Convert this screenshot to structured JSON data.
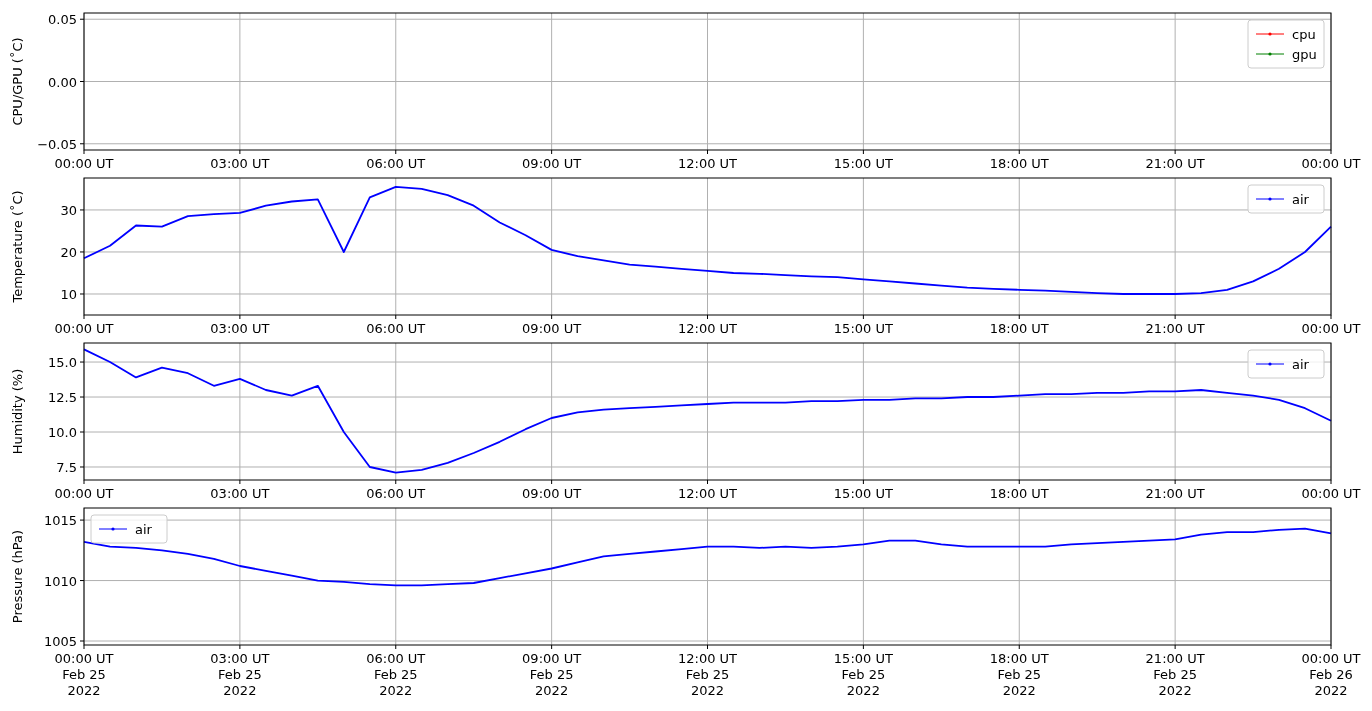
{
  "charts": [
    {
      "chart_data": {
        "type": "line",
        "ylabel": "CPU/GPU (˚C)",
        "grid": true,
        "categories": [
          "00:00 UT",
          null,
          null,
          null,
          null,
          null,
          "03:00 UT",
          null,
          null,
          null,
          null,
          null,
          "06:00 UT",
          null,
          null,
          null,
          null,
          null,
          "09:00 UT",
          null,
          null,
          null,
          null,
          null,
          "12:00 UT",
          null,
          null,
          null,
          null,
          null,
          "15:00 UT",
          null,
          null,
          null,
          null,
          null,
          "18:00 UT",
          null,
          null,
          null,
          null,
          null,
          "21:00 UT",
          null,
          null,
          null,
          null,
          null,
          "00:00 UT"
        ],
        "ylim": [
          -0.055,
          0.055
        ],
        "yticks": [
          {
            "value": -0.05,
            "label": "−0.05"
          },
          {
            "value": 0,
            "label": "0.00"
          },
          {
            "value": 0.05,
            "label": "0.05"
          }
        ],
        "series": [
          {
            "name": "cpu",
            "color": "#ff0000",
            "values": [
              null,
              null,
              null,
              null,
              null,
              null,
              null,
              null,
              null,
              null,
              null,
              null,
              null,
              null,
              null,
              null,
              null,
              null,
              null,
              null,
              null,
              null,
              null,
              null,
              null,
              null,
              null,
              null,
              null,
              null,
              null,
              null,
              null,
              null,
              null,
              null,
              null,
              null,
              null,
              null,
              null,
              null,
              null,
              null,
              null,
              null,
              null,
              null,
              null
            ]
          },
          {
            "name": "gpu",
            "color": "#008000",
            "values": [
              null,
              null,
              null,
              null,
              null,
              null,
              null,
              null,
              null,
              null,
              null,
              null,
              null,
              null,
              null,
              null,
              null,
              null,
              null,
              null,
              null,
              null,
              null,
              null,
              null,
              null,
              null,
              null,
              null,
              null,
              null,
              null,
              null,
              null,
              null,
              null,
              null,
              null,
              null,
              null,
              null,
              null,
              null,
              null,
              null,
              null,
              null,
              null,
              null
            ]
          }
        ]
      }
    },
    {
      "chart_data": {
        "type": "line",
        "ylabel": "Temperature (˚C)",
        "grid": true,
        "categories": [
          "00:00 UT",
          null,
          null,
          null,
          null,
          null,
          "03:00 UT",
          null,
          null,
          null,
          null,
          null,
          "06:00 UT",
          null,
          null,
          null,
          null,
          null,
          "09:00 UT",
          null,
          null,
          null,
          null,
          null,
          "12:00 UT",
          null,
          null,
          null,
          null,
          null,
          "15:00 UT",
          null,
          null,
          null,
          null,
          null,
          "18:00 UT",
          null,
          null,
          null,
          null,
          null,
          "21:00 UT",
          null,
          null,
          null,
          null,
          null,
          "00:00 UT"
        ],
        "ylim": [
          5,
          37.6
        ],
        "yticks": [
          {
            "value": 10,
            "label": "10"
          },
          {
            "value": 20,
            "label": "20"
          },
          {
            "value": 30,
            "label": "30"
          }
        ],
        "series": [
          {
            "name": "air",
            "color": "#0000ff",
            "values": [
              18.5,
              21.5,
              26.3,
              26,
              28.5,
              29,
              29.3,
              31,
              32,
              32.5,
              20,
              33,
              35.5,
              35,
              33.5,
              31,
              27,
              24,
              20.5,
              19,
              18,
              17,
              16.5,
              16,
              15.5,
              15,
              14.8,
              14.5,
              14.2,
              14,
              13.5,
              13,
              12.5,
              12,
              11.5,
              11.2,
              11,
              10.8,
              10.5,
              10.2,
              10,
              10,
              10,
              10.2,
              11,
              13,
              16,
              20,
              26
            ]
          }
        ]
      }
    },
    {
      "chart_data": {
        "type": "line",
        "ylabel": "Humidity (%)",
        "grid": true,
        "categories": [
          "00:00 UT",
          null,
          null,
          null,
          null,
          null,
          "03:00 UT",
          null,
          null,
          null,
          null,
          null,
          "06:00 UT",
          null,
          null,
          null,
          null,
          null,
          "09:00 UT",
          null,
          null,
          null,
          null,
          null,
          "12:00 UT",
          null,
          null,
          null,
          null,
          null,
          "15:00 UT",
          null,
          null,
          null,
          null,
          null,
          "18:00 UT",
          null,
          null,
          null,
          null,
          null,
          "21:00 UT",
          null,
          null,
          null,
          null,
          null,
          "00:00 UT"
        ],
        "ylim": [
          6.57,
          16.36
        ],
        "yticks": [
          {
            "value": 7.5,
            "label": "7.5"
          },
          {
            "value": 10,
            "label": "10.0"
          },
          {
            "value": 12.5,
            "label": "12.5"
          },
          {
            "value": 15,
            "label": "15.0"
          }
        ],
        "series": [
          {
            "name": "air",
            "color": "#0000ff",
            "values": [
              15.9,
              15,
              13.9,
              14.6,
              14.2,
              13.3,
              13.8,
              13,
              12.6,
              13.3,
              10,
              7.5,
              7.1,
              7.3,
              7.8,
              8.5,
              9.3,
              10.2,
              11,
              11.4,
              11.6,
              11.7,
              11.8,
              11.9,
              12,
              12.1,
              12.1,
              12.1,
              12.2,
              12.2,
              12.3,
              12.3,
              12.4,
              12.4,
              12.5,
              12.5,
              12.6,
              12.7,
              12.7,
              12.8,
              12.8,
              12.9,
              12.9,
              13,
              12.8,
              12.6,
              12.3,
              11.7,
              10.8
            ]
          }
        ]
      }
    },
    {
      "chart_data": {
        "type": "line",
        "ylabel": "Pressure (hPa)",
        "grid": true,
        "categories": [
          "00:00 UT\nFeb 25\n2022",
          null,
          null,
          null,
          null,
          null,
          "03:00 UT\nFeb 25\n2022",
          null,
          null,
          null,
          null,
          null,
          "06:00 UT\nFeb 25\n2022",
          null,
          null,
          null,
          null,
          null,
          "09:00 UT\nFeb 25\n2022",
          null,
          null,
          null,
          null,
          null,
          "12:00 UT\nFeb 25\n2022",
          null,
          null,
          null,
          null,
          null,
          "15:00 UT\nFeb 25\n2022",
          null,
          null,
          null,
          null,
          null,
          "18:00 UT\nFeb 25\n2022",
          null,
          null,
          null,
          null,
          null,
          "21:00 UT\nFeb 25\n2022",
          null,
          null,
          null,
          null,
          null,
          "00:00 UT\nFeb 26\n2022"
        ],
        "ylim": [
          1004.67,
          1016
        ],
        "yticks": [
          {
            "value": 1005,
            "label": "1005"
          },
          {
            "value": 1010,
            "label": "1010"
          },
          {
            "value": 1015,
            "label": "1015"
          }
        ],
        "series": [
          {
            "name": "air",
            "color": "#0000ff",
            "values": [
              1013.2,
              1012.8,
              1012.7,
              1012.5,
              1012.2,
              1011.8,
              1011.2,
              1010.8,
              1010.4,
              1010,
              1009.9,
              1009.7,
              1009.6,
              1009.6,
              1009.7,
              1009.8,
              1010.2,
              1010.6,
              1011,
              1011.5,
              1012,
              1012.2,
              1012.4,
              1012.6,
              1012.8,
              1012.8,
              1012.7,
              1012.8,
              1012.7,
              1012.8,
              1013,
              1013.3,
              1013.3,
              1013,
              1012.8,
              1012.8,
              1012.8,
              1012.8,
              1013,
              1013.1,
              1013.2,
              1013.3,
              1013.4,
              1013.8,
              1014,
              1014,
              1014.2,
              1014.3,
              1013.9
            ]
          }
        ]
      }
    }
  ]
}
